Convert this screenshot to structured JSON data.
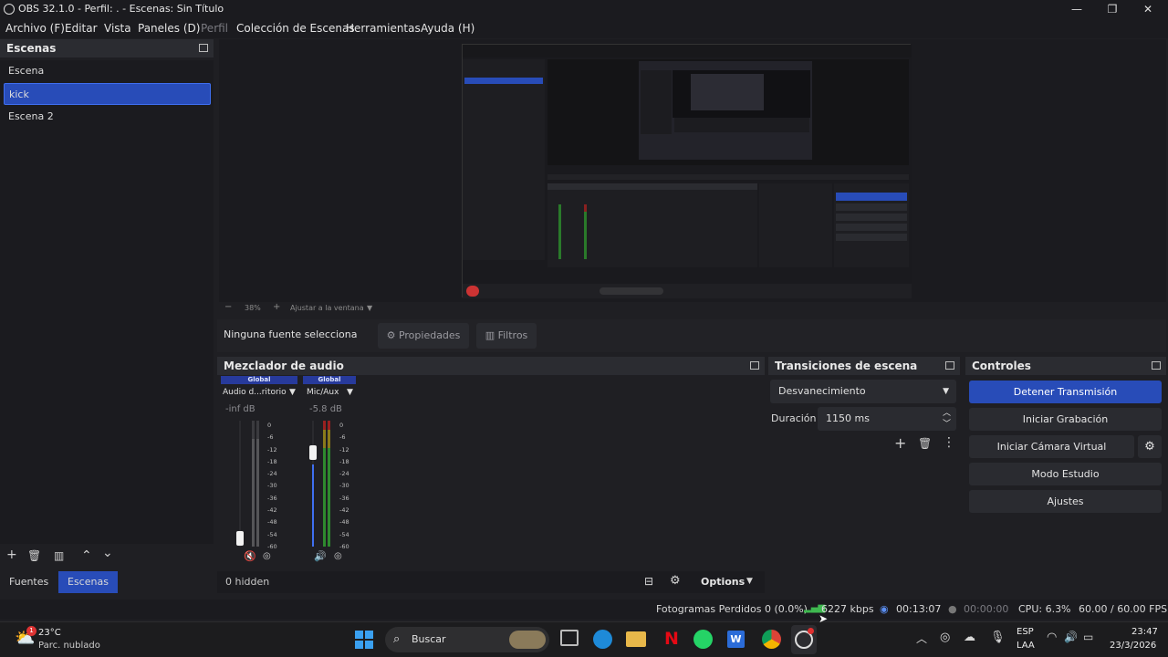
{
  "window": {
    "title": "OBS 32.1.0 - Perfil: . - Escenas: Sin Título",
    "minimize": "—",
    "maximize": "❐",
    "close": "✕"
  },
  "menu": [
    "Archivo (F)",
    "Editar",
    "Vista",
    "Paneles (D)",
    "Perfil",
    "Colección de Escenas",
    "Herramientas",
    "Ayuda (H)"
  ],
  "scenes": {
    "title": "Escenas",
    "items": [
      "Escena",
      "kick",
      "Escena 2"
    ],
    "selected_index": 1
  },
  "dock_tabs": {
    "fuentes": "Fuentes",
    "escenas": "Escenas"
  },
  "preview": {
    "zoom": "38%",
    "fit_label": "Ajustar a la ventana",
    "zoom_minus": "−",
    "zoom_plus": "+"
  },
  "source_bar": {
    "no_source": "Ninguna fuente selecciona",
    "properties": "Propiedades",
    "filters": "Filtros"
  },
  "mixer": {
    "title": "Mezclador de audio",
    "channels": [
      {
        "tag": "Global",
        "name": "Audio d...ritorio",
        "db": "-inf dB",
        "level": 0.0,
        "muted": true
      },
      {
        "tag": "Global",
        "name": "Mic/Aux",
        "db": "-5.8 dB",
        "level": 0.78,
        "muted": false
      }
    ],
    "scale": [
      "0",
      "-6",
      "-12",
      "-18",
      "-24",
      "-30",
      "-36",
      "-42",
      "-48",
      "-54",
      "-60"
    ],
    "hidden_count": "0 hidden",
    "options": "Options"
  },
  "transitions": {
    "title": "Transiciones de escena",
    "selected": "Desvanecimiento",
    "duration_label": "Duración",
    "duration_value": "1150 ms"
  },
  "controls": {
    "title": "Controles",
    "stop_stream": "Detener Transmisión",
    "start_record": "Iniciar Grabación",
    "start_virtual_cam": "Iniciar Cámara Virtual",
    "studio_mode": "Modo Estudio",
    "settings": "Ajustes"
  },
  "status": {
    "dropped_frames": "Fotogramas Perdidos 0 (0.0%)",
    "bitrate": "6227 kbps",
    "stream_time": "00:13:07",
    "record_time": "00:00:00",
    "cpu": "CPU: 6.3%",
    "fps": "60.00 / 60.00 FPS"
  },
  "taskbar": {
    "weather_temp": "23°C",
    "weather_desc": "Parc. nublado",
    "weather_badge": "1",
    "search": "Buscar",
    "lang_top": "ESP",
    "lang_bottom": "LAA",
    "time": "23:47",
    "date": "23/3/2026"
  },
  "colors": {
    "accent": "#284cb8",
    "panel": "#1f1f23",
    "header": "#2b2c31"
  }
}
